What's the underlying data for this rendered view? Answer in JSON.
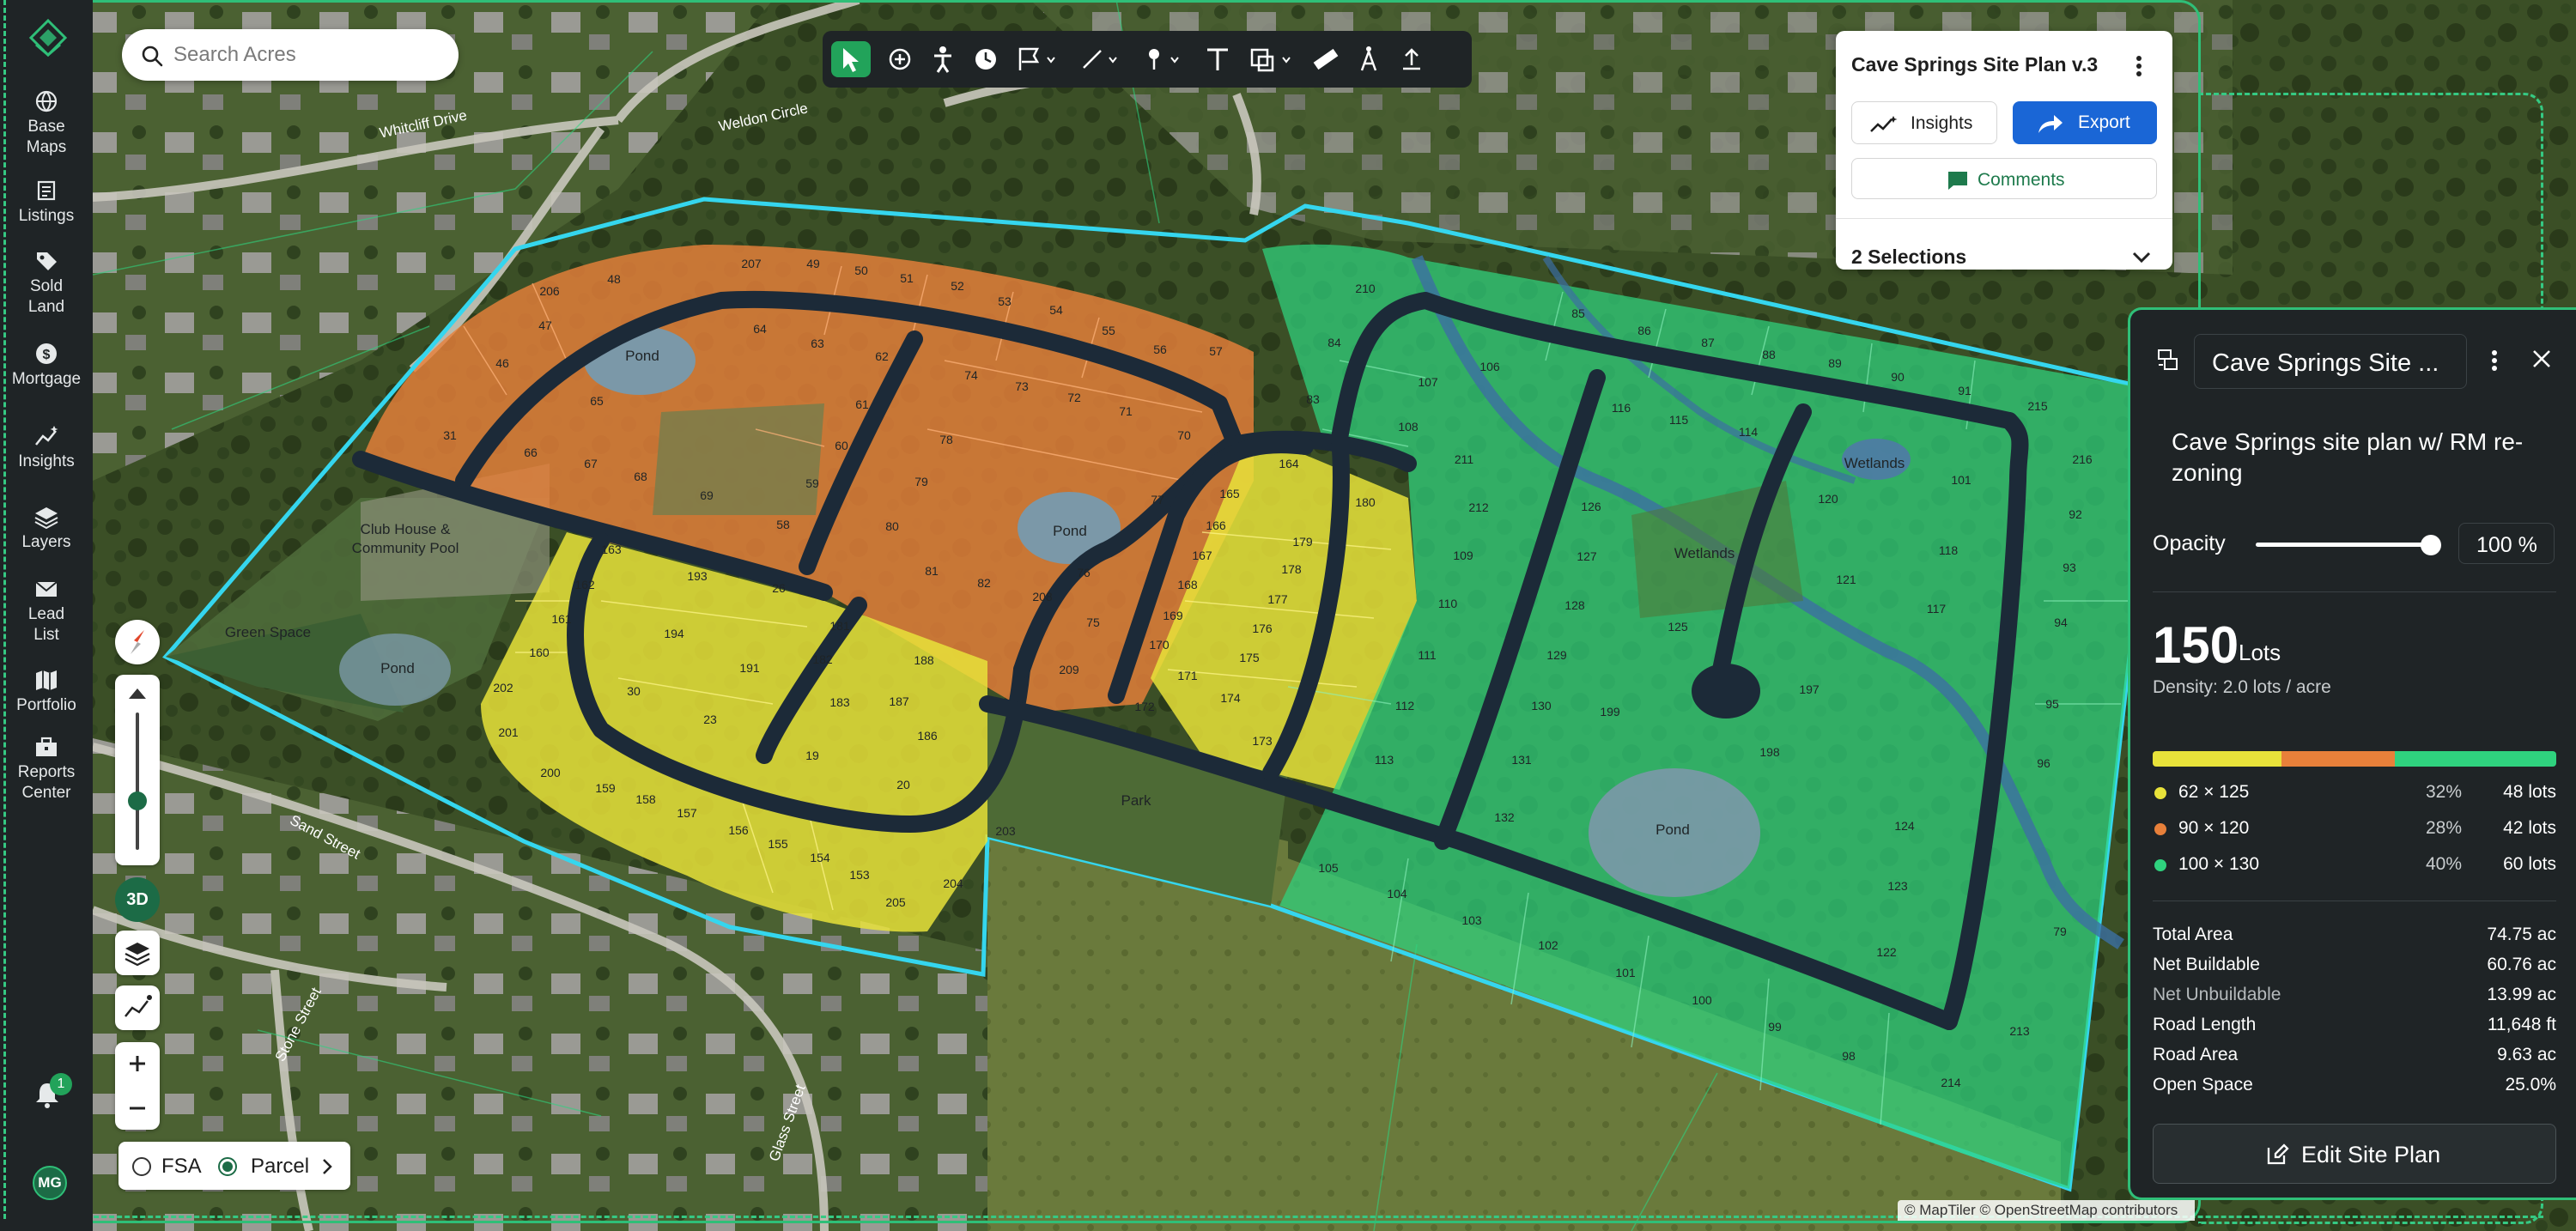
{
  "nav": {
    "items": [
      {
        "label": "Base\nMaps",
        "icon": "globe-icon"
      },
      {
        "label": "Listings",
        "icon": "listings-icon"
      },
      {
        "label": "Sold\nLand",
        "icon": "tag-icon"
      },
      {
        "label": "Mortgage",
        "icon": "dollar-icon"
      },
      {
        "label": "Insights",
        "icon": "insights-icon"
      },
      {
        "label": "Layers",
        "icon": "layers-icon"
      },
      {
        "label": "Lead\nList",
        "icon": "mail-icon"
      },
      {
        "label": "Portfolio",
        "icon": "map-icon"
      },
      {
        "label": "Reports\nCenter",
        "icon": "briefcase-icon"
      }
    ],
    "notification_count": "1",
    "avatar_initials": "MG"
  },
  "search": {
    "placeholder": "Search Acres"
  },
  "toolbar": {
    "tools": [
      "select-tool",
      "add-tool",
      "person-tool",
      "clock-tool",
      "flag-tool",
      "line-tool",
      "pin-tool",
      "text-tool",
      "shape-tool",
      "ruler-tool",
      "compass-tool",
      "upload-tool"
    ]
  },
  "plan_card": {
    "title": "Cave Springs Site Plan v.3",
    "insights_label": "Insights",
    "export_label": "Export",
    "comments_label": "Comments",
    "selections_label": "2 Selections"
  },
  "panel": {
    "name": "Cave Springs Site ...",
    "description": "Cave Springs site plan w/ RM re-zoning",
    "opacity_label": "Opacity",
    "opacity_value": "100 %",
    "opacity_fraction": 1.0,
    "lots_count": "150",
    "lots_word": "Lots",
    "density": "Density: 2.0 lots / acre",
    "breakdown": [
      {
        "label": "62 × 125",
        "pct": "32%",
        "count": "48 lots",
        "color": "#e8e23a",
        "share": 32
      },
      {
        "label": "90 × 120",
        "pct": "28%",
        "count": "42 lots",
        "color": "#e8803a",
        "share": 28
      },
      {
        "label": "100 × 130",
        "pct": "40%",
        "count": "60 lots",
        "color": "#2fd27e",
        "share": 40
      }
    ],
    "stats": [
      {
        "label": "Total Area",
        "value": "74.75 ac"
      },
      {
        "label": "Net Buildable",
        "value": "60.76 ac"
      },
      {
        "label": "Net Unbuildable",
        "value": "13.99 ac"
      },
      {
        "label": "Road Length",
        "value": "11,648 ft"
      },
      {
        "label": "Road Area",
        "value": "9.63 ac"
      },
      {
        "label": "Open Space",
        "value": "25.0%"
      }
    ],
    "edit_label": "Edit Site Plan"
  },
  "map": {
    "labels": {
      "pond_nw": "Pond",
      "pond_center": "Pond",
      "pond_west": "Pond",
      "pond_se": "Pond",
      "wetlands_1": "Wetlands",
      "wetlands_2": "Wetlands",
      "clubhouse_1": "Club House &",
      "clubhouse_2": "Community Pool",
      "green_space": "Green Space",
      "park": "Park"
    },
    "streets": {
      "sand": "Sand Street",
      "stone": "Stone Street",
      "glass": "Glass Street",
      "whitcliff": "Whitcliff Drive",
      "weldon": "Weldon Circle"
    },
    "lots": {
      "orange": [
        "206",
        "48",
        "207",
        "49",
        "50",
        "51",
        "52",
        "53",
        "54",
        "55",
        "56",
        "57",
        "47",
        "46",
        "64",
        "63",
        "62",
        "65",
        "61",
        "31",
        "66",
        "67",
        "68",
        "69",
        "60",
        "59",
        "58",
        "74",
        "73",
        "72",
        "71",
        "70",
        "78",
        "79",
        "80",
        "81",
        "82",
        "208",
        "76",
        "77",
        "75",
        "209"
      ],
      "yellow": [
        "163",
        "162",
        "161",
        "160",
        "202",
        "201",
        "200",
        "159",
        "158",
        "157",
        "193",
        "26",
        "194",
        "191",
        "30",
        "23",
        "181",
        "188",
        "182",
        "187",
        "183",
        "186",
        "19",
        "20",
        "156",
        "155",
        "154",
        "153",
        "205",
        "204",
        "203",
        "164",
        "165",
        "180",
        "166",
        "179",
        "167",
        "178",
        "168",
        "177",
        "169",
        "176",
        "170",
        "175",
        "171",
        "174",
        "172",
        "173"
      ],
      "green": [
        "210",
        "84",
        "83",
        "107",
        "106",
        "108",
        "211",
        "212",
        "109",
        "110",
        "111",
        "112",
        "113",
        "85",
        "86",
        "87",
        "88",
        "89",
        "90",
        "91",
        "215",
        "116",
        "115",
        "114",
        "126",
        "127",
        "128",
        "129",
        "130",
        "131",
        "132",
        "216",
        "92",
        "93",
        "94",
        "95",
        "96",
        "120",
        "101",
        "118",
        "121",
        "117",
        "125",
        "199",
        "197",
        "198",
        "105",
        "104",
        "103",
        "102",
        "101",
        "100",
        "99",
        "98",
        "124",
        "123",
        "122",
        "79",
        "213",
        "214"
      ]
    },
    "attribution": "© MapTiler © OpenStreetMap contributors"
  },
  "controls": {
    "btn_3d": "3D",
    "fsa_label": "FSA",
    "parcel_label": "Parcel"
  }
}
